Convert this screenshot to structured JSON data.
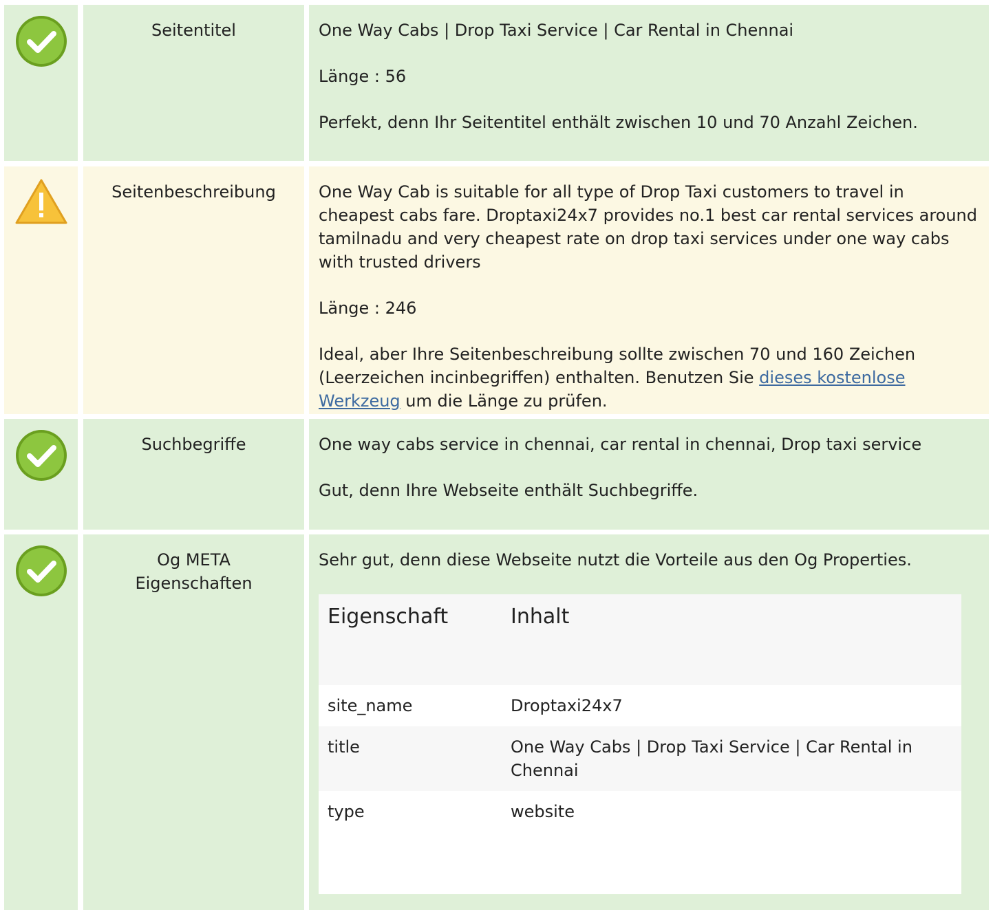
{
  "rows": [
    {
      "status": "ok",
      "label": "Seitentitel",
      "paragraphs": [
        "One Way Cabs | Drop Taxi Service | Car Rental in Chennai",
        "Länge : 56",
        "Perfekt, denn Ihr Seitentitel enthält zwischen 10 und 70 Anzahl Zeichen."
      ]
    },
    {
      "status": "warning",
      "label": "Seitenbeschreibung",
      "paragraphs": [
        "One Way Cab is suitable for all type of Drop Taxi customers to travel in cheapest cabs fare. Droptaxi24x7 provides no.1 best car rental services around tamilnadu and very cheapest rate on drop taxi services under one way cabs with trusted drivers",
        "Länge : 246"
      ],
      "advice_before": "Ideal, aber Ihre Seitenbeschreibung sollte zwischen 70 und 160 Zeichen (Leerzeichen incinbegriffen) enthalten. Benutzen Sie ",
      "advice_link": "dieses kostenlose Werkzeug",
      "advice_after": " um die Länge zu prüfen."
    },
    {
      "status": "ok",
      "label": "Suchbegriffe",
      "paragraphs": [
        "One way cabs service in chennai, car rental in chennai, Drop taxi service",
        "Gut, denn Ihre Webseite enthält Suchbegriffe."
      ]
    },
    {
      "status": "ok",
      "label": "Og META Eigenschaften",
      "paragraphs": [
        "Sehr gut, denn diese Webseite nutzt die Vorteile aus den Og Properties."
      ],
      "table": {
        "headers": [
          "Eigenschaft",
          "Inhalt"
        ],
        "rows": [
          [
            "site_name",
            "Droptaxi24x7"
          ],
          [
            "title",
            "One Way Cabs | Drop Taxi Service | Car Rental in Chennai"
          ],
          [
            "type",
            "website"
          ]
        ]
      }
    }
  ],
  "colors": {
    "ok_background": "#dff0d8",
    "warning_background": "#fcf8e3",
    "ok_icon": "#8dc63f",
    "warning_icon": "#f7c23a",
    "link": "#3d6aa0"
  },
  "icons": {
    "ok": "check-circle-icon",
    "warning": "warning-triangle-icon"
  }
}
